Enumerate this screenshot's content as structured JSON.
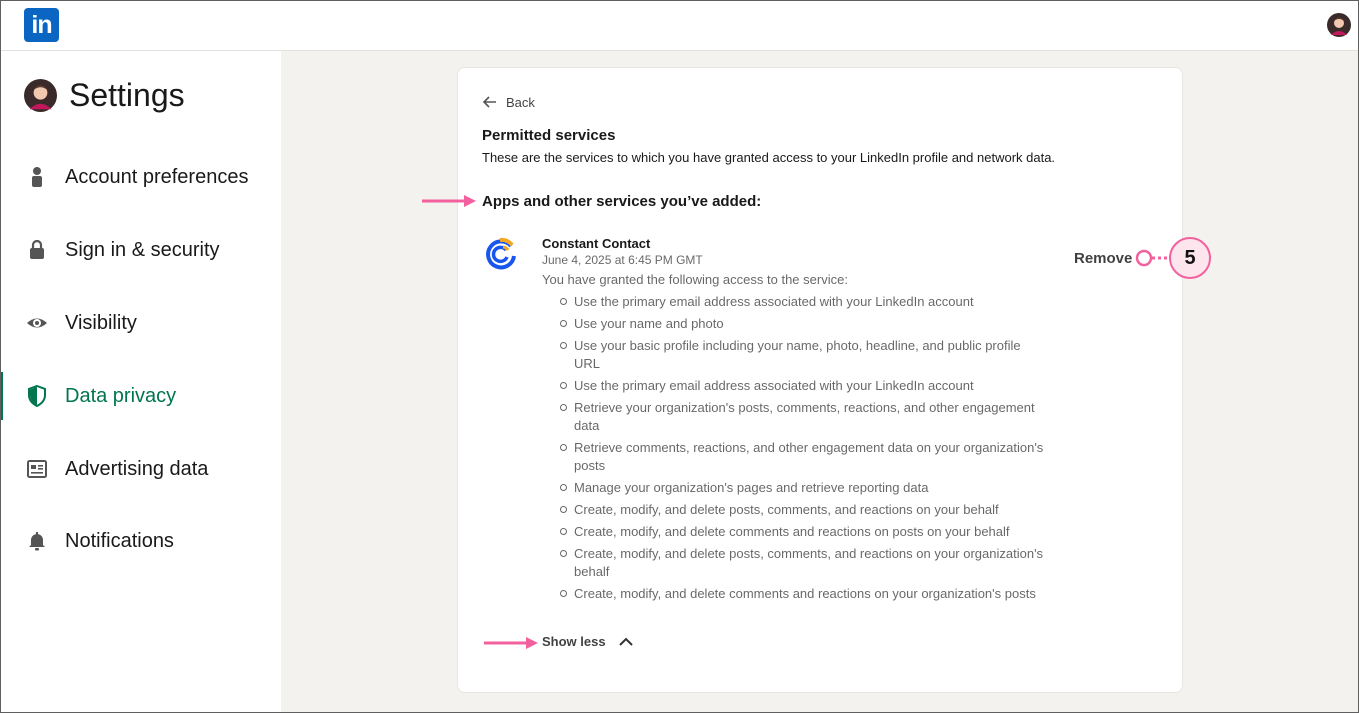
{
  "topbar": {
    "logo_text": "in",
    "logo_icon": "linkedin-logo",
    "avatar_icon": "user-avatar"
  },
  "sidebar": {
    "title": "Settings",
    "items": [
      {
        "label": "Account preferences",
        "icon": "person-icon"
      },
      {
        "label": "Sign in & security",
        "icon": "lock-icon"
      },
      {
        "label": "Visibility",
        "icon": "eye-icon"
      },
      {
        "label": "Data privacy",
        "icon": "shield-icon",
        "active": true
      },
      {
        "label": "Advertising data",
        "icon": "newspaper-icon"
      },
      {
        "label": "Notifications",
        "icon": "bell-icon"
      }
    ]
  },
  "main": {
    "back_label": "Back",
    "heading": "Permitted services",
    "subheading": "These are the services to which you have granted access to your LinkedIn profile and network data.",
    "section_title": "Apps and other services you’ve added:",
    "service": {
      "name": "Constant Contact",
      "date": "June 4, 2025 at 6:45 PM GMT",
      "granted_intro": "You have granted the following access to the service:",
      "remove_label": "Remove",
      "permissions": [
        "Use the primary email address associated with your LinkedIn account",
        "Use your name and photo",
        "Use your basic profile including your name, photo, headline, and public profile URL",
        "Use the primary email address associated with your LinkedIn account",
        "Retrieve your organization's posts, comments, reactions, and other engagement data",
        "Retrieve comments, reactions, and other engagement data on your organization's posts",
        "Manage your organization's pages and retrieve reporting data",
        "Create, modify, and delete posts, comments, and reactions on your behalf",
        "Create, modify, and delete comments and reactions on posts on your behalf",
        "Create, modify, and delete posts, comments, and reactions on your organization's behalf",
        "Create, modify, and delete comments and reactions on your organization's posts"
      ],
      "show_less_label": "Show less"
    }
  },
  "annotations": {
    "callout_number": "5",
    "accent_color": "#f2609e"
  },
  "colors": {
    "brand": "#0a66c2",
    "active_nav": "#01754f",
    "page_bg": "#f4f2ee"
  }
}
